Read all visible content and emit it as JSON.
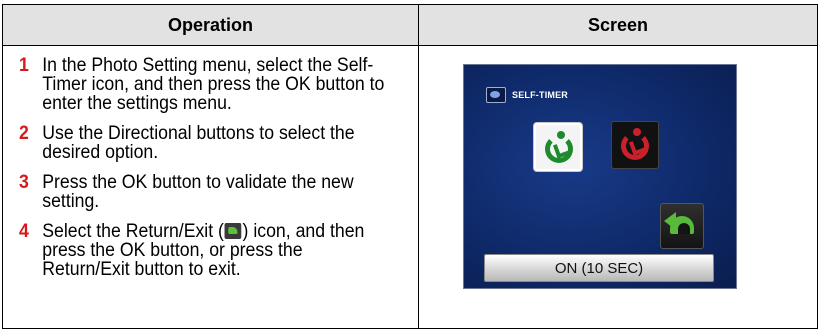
{
  "table": {
    "headers": {
      "operation": "Operation",
      "screen": "Screen"
    }
  },
  "steps": [
    {
      "num": "1",
      "text": "In the Photo Setting menu, select the Self-Timer icon, and then press the OK button to enter the settings menu."
    },
    {
      "num": "2",
      "text": "Use the Directional buttons to select the desired option."
    },
    {
      "num": "3",
      "text": "Press the OK button to validate the new setting."
    },
    {
      "num": "4",
      "text_before": "Select the Return/Exit (",
      "icon": "return-exit-icon",
      "text_after": ") icon, and then press the OK button, or press the Return/Exit button to exit."
    }
  ],
  "screen": {
    "title": "SELF-TIMER",
    "title_icon": "self-timer-icon",
    "options": [
      {
        "name": "self-timer-off",
        "icon": "timer-icon",
        "color": "#1d8a2c",
        "selected": true
      },
      {
        "name": "self-timer-on",
        "icon": "timer-icon",
        "color": "#c8212b",
        "selected": false
      }
    ],
    "return_icon": "return-arrow-icon",
    "status": "ON (10 SEC)"
  },
  "colors": {
    "step_number": "#d61a1a",
    "header_bg": "#e2e2e2",
    "screen_bg": "#0f2a6a"
  }
}
